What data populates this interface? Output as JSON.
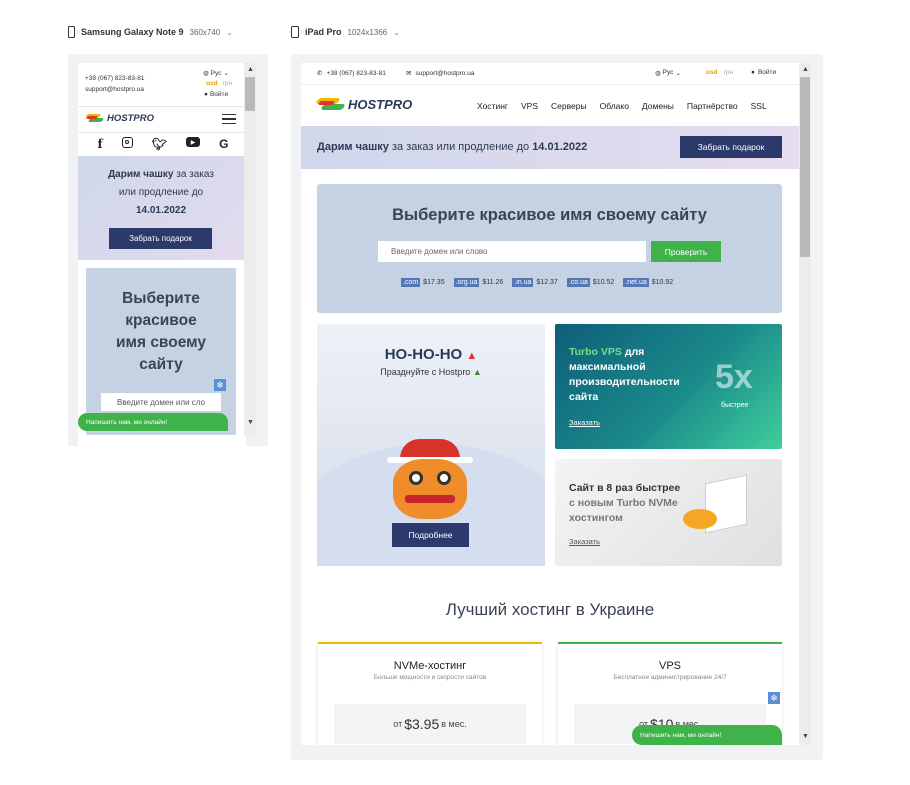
{
  "devices": [
    {
      "name": "Samsung Galaxy Note 9",
      "dims": "360x740"
    },
    {
      "name": "iPad Pro",
      "dims": "1024x1366"
    }
  ],
  "contact": {
    "phone": "+38 (067) 823-83-81",
    "email": "support@hostpro.ua"
  },
  "lang": "Рус",
  "currency": {
    "active": "usd",
    "inactive": "грн"
  },
  "login": "Войти",
  "brand": "HOSTPRO",
  "social_icons": [
    "facebook-icon",
    "instagram-icon",
    "twitter-icon",
    "youtube-icon",
    "google-icon"
  ],
  "nav": [
    "Хостинг",
    "VPS",
    "Серверы",
    "Облако",
    "Домены",
    "Партнёрство",
    "SSL"
  ],
  "promo": {
    "text_bold": "Дарим чашку",
    "text_rest": "за заказ или продление до",
    "date": "14.01.2022",
    "mobile_line1_rest": "за заказ",
    "mobile_line2": "или продление до",
    "button": "Забрать подарок"
  },
  "domain_search": {
    "title": "Выберите красивое имя своему сайту",
    "mobile_title_lines": [
      "Выберите",
      "красивое",
      "имя своему",
      "сайту"
    ],
    "placeholder": "Введите домен или слово",
    "mobile_placeholder": "Введите домен или сло",
    "button": "Проверить",
    "tlds": [
      {
        "tld": ".com",
        "price": "$17.35"
      },
      {
        "tld": ".org.ua",
        "price": "$11.26"
      },
      {
        "tld": ".in.ua",
        "price": "$12.37"
      },
      {
        "tld": ".co.ua",
        "price": "$10.52"
      },
      {
        "tld": ".net.ua",
        "price": "$10.92"
      }
    ]
  },
  "hoho": {
    "title": "НО-НО-НО",
    "subtitle": "Празднуйте с Hostpro",
    "button": "Подробнее"
  },
  "turbo_vps": {
    "accent": "Turbo VPS",
    "text": "для максимальной производительности сайта",
    "big": "5x",
    "big_sub": "быстрее",
    "link": "Заказать"
  },
  "nvme_promo": {
    "line1": "Сайт в 8 раз быстрее",
    "line2": "с новым Turbo NVMe",
    "line3": "хостингом",
    "link": "Заказать"
  },
  "section_title": "Лучший хостинг в Украине",
  "plans": [
    {
      "name": "NVMe-хостинг",
      "desc": "Больше мощности и скорости сайтов",
      "from": "от",
      "price": "$3.95",
      "per": "в мес.",
      "accent": "#f2b705"
    },
    {
      "name": "VPS",
      "desc": "Бесплатное администрирование 24/7",
      "from": "от",
      "price": "$10",
      "per": "в мес.",
      "accent": "#3fb24a"
    }
  ],
  "chat": "Напишить нам, ми онлайн!",
  "colors": {
    "dark_button": "#2b3a6a",
    "green": "#3fb24a",
    "usd": "#e0a000",
    "tld_bg": "#5577b5"
  }
}
